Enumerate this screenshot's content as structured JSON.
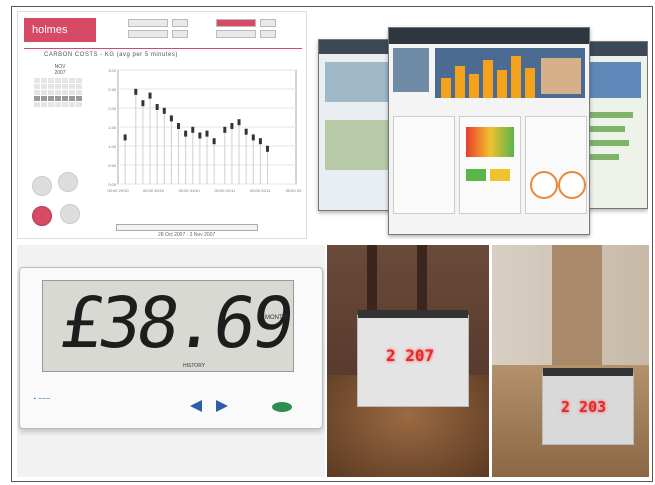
{
  "app": {
    "logo_text": "holmes",
    "graph_title": "CARBON COSTS - KG (avg per 5 minutes)",
    "calendar": {
      "month": "NOV",
      "year": "2007"
    },
    "date_range": "28 Oct 2007 - 3 Nov 2007",
    "y_ticks": [
      "3.00",
      "2.50",
      "2.00",
      "1.50",
      "1.00",
      "0.50",
      "0.00"
    ],
    "x_ticks": [
      "00:00 29/10",
      "00:00 30/10",
      "00:00 31/10",
      "00:00 01/11",
      "00:00 02/11",
      "00:00 03/11"
    ],
    "colors": {
      "brand": "#d64a65"
    }
  },
  "display": {
    "reading": "£38.69",
    "unit_label": "MONTH",
    "history_label": "HISTORY",
    "colors": {
      "lcd": "#d9d9d4",
      "green_button": "#2f8c53",
      "arrows": "#2d5fa8"
    }
  },
  "clock_left": {
    "reading": "2 207",
    "color": "#e2292b"
  },
  "clock_right": {
    "reading": "2 203",
    "color": "#e2292b"
  },
  "chart_data": {
    "type": "scatter",
    "title": "CARBON COSTS - KG (avg per 5 minutes)",
    "x": [
      0.2,
      0.5,
      0.7,
      0.9,
      1.1,
      1.3,
      1.5,
      1.7,
      1.9,
      2.1,
      2.3,
      2.5,
      2.7,
      3.0,
      3.2,
      3.4,
      3.6,
      3.8,
      4.0,
      4.2
    ],
    "values": [
      1.2,
      2.4,
      2.1,
      2.3,
      2.0,
      1.9,
      1.7,
      1.5,
      1.3,
      1.4,
      1.25,
      1.3,
      1.1,
      1.4,
      1.5,
      1.6,
      1.35,
      1.2,
      1.1,
      0.9
    ],
    "ylim": [
      0,
      3
    ],
    "grid": true
  }
}
